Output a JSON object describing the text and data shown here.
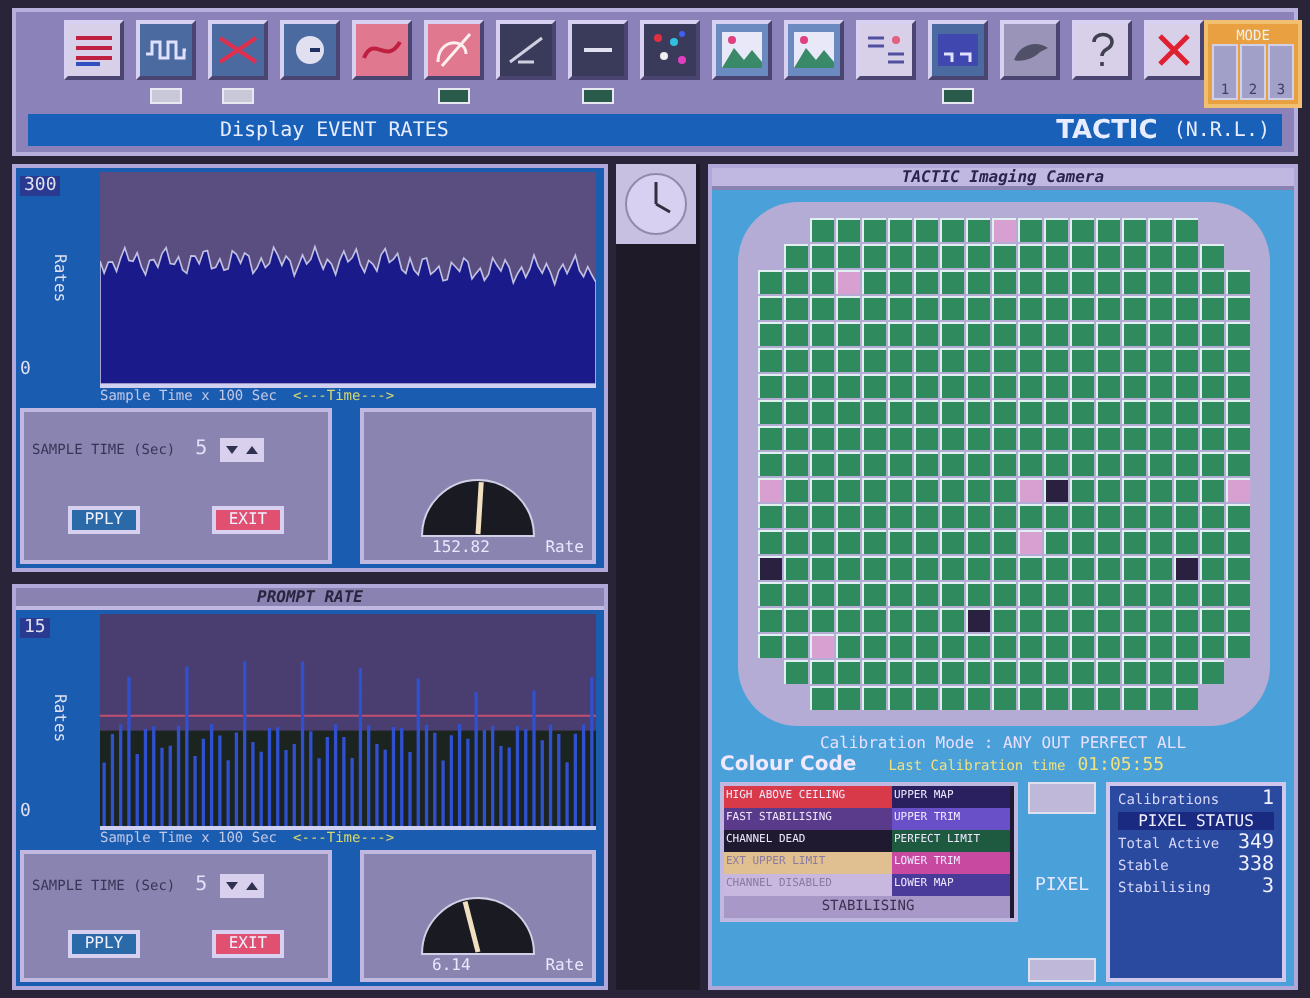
{
  "toolbar": {
    "tools": [
      {
        "kind": "lines"
      },
      {
        "kind": "wave",
        "indicator": {
          "on": false
        }
      },
      {
        "kind": "cross",
        "indicator": {
          "on": false
        }
      },
      {
        "kind": "dial"
      },
      {
        "kind": "curve"
      },
      {
        "kind": "hook",
        "indicator": {
          "on": true
        }
      },
      {
        "kind": "scope"
      },
      {
        "kind": "dash",
        "indicator": {
          "on": true
        }
      },
      {
        "kind": "dots"
      },
      {
        "kind": "hills"
      },
      {
        "kind": "hills"
      },
      {
        "kind": "table"
      },
      {
        "kind": "screen",
        "indicator": {
          "on": true
        }
      },
      {
        "kind": "creature"
      },
      {
        "kind": "help"
      },
      {
        "kind": "close"
      }
    ],
    "mode": {
      "title": "MODE",
      "buttons": [
        "1",
        "2",
        "3"
      ]
    }
  },
  "status_bar": {
    "message": "Display EVENT RATES",
    "app": "TACTIC",
    "org": "(N.R.L.)"
  },
  "rate_panels": [
    {
      "ymax": "300",
      "ymin": "0",
      "ylabel": "Rates",
      "xlabel": "Sample Time x 100 Sec",
      "time_label": "<---Time--->",
      "sample_label": "SAMPLE TIME (Sec)",
      "sample_value": "5",
      "apply": "PPLY",
      "exit": "EXIT",
      "gauge": {
        "reading": "152.82",
        "label": "Rate"
      }
    },
    {
      "title": "PROMPT RATE",
      "ymax": "15",
      "ymin": "0",
      "ylabel": "Rates",
      "xlabel": "Sample Time x 100 Sec",
      "time_label": "<---Time--->",
      "sample_label": "SAMPLE TIME (Sec)",
      "sample_value": "5",
      "apply": "PPLY",
      "exit": "EXIT",
      "gauge": {
        "reading": "6.14",
        "label": "Rate"
      }
    }
  ],
  "camera": {
    "title": "TACTIC Imaging Camera",
    "rows": [
      [
        {
          "kind": "ok"
        },
        {
          "kind": "ok"
        },
        {
          "kind": "ok"
        },
        {
          "kind": "ok"
        },
        {
          "kind": "ok"
        },
        {
          "kind": "ok"
        },
        {
          "kind": "ok"
        },
        {
          "kind": "hot"
        },
        {
          "kind": "ok"
        },
        {
          "kind": "ok"
        },
        {
          "kind": "ok"
        },
        {
          "kind": "ok"
        },
        {
          "kind": "ok"
        },
        {
          "kind": "ok"
        },
        {
          "kind": "ok"
        }
      ],
      [
        {
          "kind": "ok"
        },
        {
          "kind": "ok"
        },
        {
          "kind": "ok"
        },
        {
          "kind": "ok"
        },
        {
          "kind": "ok"
        },
        {
          "kind": "ok"
        },
        {
          "kind": "ok"
        },
        {
          "kind": "ok"
        },
        {
          "kind": "ok"
        },
        {
          "kind": "ok"
        },
        {
          "kind": "ok"
        },
        {
          "kind": "ok"
        },
        {
          "kind": "ok"
        },
        {
          "kind": "ok"
        },
        {
          "kind": "ok"
        },
        {
          "kind": "ok"
        },
        {
          "kind": "ok"
        }
      ],
      [
        {
          "kind": "ok"
        },
        {
          "kind": "ok"
        },
        {
          "kind": "ok"
        },
        {
          "kind": "hot"
        },
        {
          "kind": "ok"
        },
        {
          "kind": "ok"
        },
        {
          "kind": "ok"
        },
        {
          "kind": "ok"
        },
        {
          "kind": "ok"
        },
        {
          "kind": "ok"
        },
        {
          "kind": "ok"
        },
        {
          "kind": "ok"
        },
        {
          "kind": "ok"
        },
        {
          "kind": "ok"
        },
        {
          "kind": "ok"
        },
        {
          "kind": "ok"
        },
        {
          "kind": "ok"
        },
        {
          "kind": "ok"
        },
        {
          "kind": "ok"
        }
      ],
      [
        {
          "kind": "ok"
        },
        {
          "kind": "ok"
        },
        {
          "kind": "ok"
        },
        {
          "kind": "ok"
        },
        {
          "kind": "ok"
        },
        {
          "kind": "ok"
        },
        {
          "kind": "ok"
        },
        {
          "kind": "ok"
        },
        {
          "kind": "ok"
        },
        {
          "kind": "ok"
        },
        {
          "kind": "ok"
        },
        {
          "kind": "ok"
        },
        {
          "kind": "ok"
        },
        {
          "kind": "ok"
        },
        {
          "kind": "ok"
        },
        {
          "kind": "ok"
        },
        {
          "kind": "ok"
        },
        {
          "kind": "ok"
        },
        {
          "kind": "ok"
        }
      ],
      [
        {
          "kind": "ok"
        },
        {
          "kind": "ok"
        },
        {
          "kind": "ok"
        },
        {
          "kind": "ok"
        },
        {
          "kind": "ok"
        },
        {
          "kind": "ok"
        },
        {
          "kind": "ok"
        },
        {
          "kind": "ok"
        },
        {
          "kind": "ok"
        },
        {
          "kind": "ok"
        },
        {
          "kind": "ok"
        },
        {
          "kind": "ok"
        },
        {
          "kind": "ok"
        },
        {
          "kind": "ok"
        },
        {
          "kind": "ok"
        },
        {
          "kind": "ok"
        },
        {
          "kind": "ok"
        },
        {
          "kind": "ok"
        },
        {
          "kind": "ok"
        }
      ],
      [
        {
          "kind": "ok"
        },
        {
          "kind": "ok"
        },
        {
          "kind": "ok"
        },
        {
          "kind": "ok"
        },
        {
          "kind": "ok"
        },
        {
          "kind": "ok"
        },
        {
          "kind": "ok"
        },
        {
          "kind": "ok"
        },
        {
          "kind": "ok"
        },
        {
          "kind": "ok"
        },
        {
          "kind": "ok"
        },
        {
          "kind": "ok"
        },
        {
          "kind": "ok"
        },
        {
          "kind": "ok"
        },
        {
          "kind": "ok"
        },
        {
          "kind": "ok"
        },
        {
          "kind": "ok"
        },
        {
          "kind": "ok"
        },
        {
          "kind": "ok"
        }
      ],
      [
        {
          "kind": "ok"
        },
        {
          "kind": "ok"
        },
        {
          "kind": "ok"
        },
        {
          "kind": "ok"
        },
        {
          "kind": "ok"
        },
        {
          "kind": "ok"
        },
        {
          "kind": "ok"
        },
        {
          "kind": "ok"
        },
        {
          "kind": "ok"
        },
        {
          "kind": "ok"
        },
        {
          "kind": "ok"
        },
        {
          "kind": "ok"
        },
        {
          "kind": "ok"
        },
        {
          "kind": "ok"
        },
        {
          "kind": "ok"
        },
        {
          "kind": "ok"
        },
        {
          "kind": "ok"
        },
        {
          "kind": "ok"
        },
        {
          "kind": "ok"
        }
      ],
      [
        {
          "kind": "ok"
        },
        {
          "kind": "ok"
        },
        {
          "kind": "ok"
        },
        {
          "kind": "ok"
        },
        {
          "kind": "ok"
        },
        {
          "kind": "ok"
        },
        {
          "kind": "ok"
        },
        {
          "kind": "ok"
        },
        {
          "kind": "ok"
        },
        {
          "kind": "ok"
        },
        {
          "kind": "ok"
        },
        {
          "kind": "ok"
        },
        {
          "kind": "ok"
        },
        {
          "kind": "ok"
        },
        {
          "kind": "ok"
        },
        {
          "kind": "ok"
        },
        {
          "kind": "ok"
        },
        {
          "kind": "ok"
        },
        {
          "kind": "ok"
        }
      ],
      [
        {
          "kind": "ok"
        },
        {
          "kind": "ok"
        },
        {
          "kind": "ok"
        },
        {
          "kind": "ok"
        },
        {
          "kind": "ok"
        },
        {
          "kind": "ok"
        },
        {
          "kind": "ok"
        },
        {
          "kind": "ok"
        },
        {
          "kind": "ok"
        },
        {
          "kind": "ok"
        },
        {
          "kind": "ok"
        },
        {
          "kind": "ok"
        },
        {
          "kind": "ok"
        },
        {
          "kind": "ok"
        },
        {
          "kind": "ok"
        },
        {
          "kind": "ok"
        },
        {
          "kind": "ok"
        },
        {
          "kind": "ok"
        },
        {
          "kind": "ok"
        }
      ],
      [
        {
          "kind": "ok"
        },
        {
          "kind": "ok"
        },
        {
          "kind": "ok"
        },
        {
          "kind": "ok"
        },
        {
          "kind": "ok"
        },
        {
          "kind": "ok"
        },
        {
          "kind": "ok"
        },
        {
          "kind": "ok"
        },
        {
          "kind": "ok"
        },
        {
          "kind": "ok"
        },
        {
          "kind": "ok"
        },
        {
          "kind": "ok"
        },
        {
          "kind": "ok"
        },
        {
          "kind": "ok"
        },
        {
          "kind": "ok"
        },
        {
          "kind": "ok"
        },
        {
          "kind": "ok"
        },
        {
          "kind": "ok"
        },
        {
          "kind": "ok"
        }
      ],
      [
        {
          "kind": "hot"
        },
        {
          "kind": "ok"
        },
        {
          "kind": "ok"
        },
        {
          "kind": "ok"
        },
        {
          "kind": "ok"
        },
        {
          "kind": "ok"
        },
        {
          "kind": "ok"
        },
        {
          "kind": "ok"
        },
        {
          "kind": "ok"
        },
        {
          "kind": "ok"
        },
        {
          "kind": "hot"
        },
        {
          "kind": "dead"
        },
        {
          "kind": "ok"
        },
        {
          "kind": "ok"
        },
        {
          "kind": "ok"
        },
        {
          "kind": "ok"
        },
        {
          "kind": "ok"
        },
        {
          "kind": "ok"
        },
        {
          "kind": "hot"
        }
      ],
      [
        {
          "kind": "ok"
        },
        {
          "kind": "ok"
        },
        {
          "kind": "ok"
        },
        {
          "kind": "ok"
        },
        {
          "kind": "ok"
        },
        {
          "kind": "ok"
        },
        {
          "kind": "ok"
        },
        {
          "kind": "ok"
        },
        {
          "kind": "ok"
        },
        {
          "kind": "ok"
        },
        {
          "kind": "ok"
        },
        {
          "kind": "ok"
        },
        {
          "kind": "ok"
        },
        {
          "kind": "ok"
        },
        {
          "kind": "ok"
        },
        {
          "kind": "ok"
        },
        {
          "kind": "ok"
        },
        {
          "kind": "ok"
        },
        {
          "kind": "ok"
        }
      ],
      [
        {
          "kind": "ok"
        },
        {
          "kind": "ok"
        },
        {
          "kind": "ok"
        },
        {
          "kind": "ok"
        },
        {
          "kind": "ok"
        },
        {
          "kind": "ok"
        },
        {
          "kind": "ok"
        },
        {
          "kind": "ok"
        },
        {
          "kind": "ok"
        },
        {
          "kind": "ok"
        },
        {
          "kind": "hot"
        },
        {
          "kind": "ok"
        },
        {
          "kind": "ok"
        },
        {
          "kind": "ok"
        },
        {
          "kind": "ok"
        },
        {
          "kind": "ok"
        },
        {
          "kind": "ok"
        },
        {
          "kind": "ok"
        },
        {
          "kind": "ok"
        }
      ],
      [
        {
          "kind": "dead"
        },
        {
          "kind": "ok"
        },
        {
          "kind": "ok"
        },
        {
          "kind": "ok"
        },
        {
          "kind": "ok"
        },
        {
          "kind": "ok"
        },
        {
          "kind": "ok"
        },
        {
          "kind": "ok"
        },
        {
          "kind": "ok"
        },
        {
          "kind": "ok"
        },
        {
          "kind": "ok"
        },
        {
          "kind": "ok"
        },
        {
          "kind": "ok"
        },
        {
          "kind": "ok"
        },
        {
          "kind": "ok"
        },
        {
          "kind": "ok"
        },
        {
          "kind": "dead"
        },
        {
          "kind": "ok"
        },
        {
          "kind": "ok"
        }
      ],
      [
        {
          "kind": "ok"
        },
        {
          "kind": "ok"
        },
        {
          "kind": "ok"
        },
        {
          "kind": "ok"
        },
        {
          "kind": "ok"
        },
        {
          "kind": "ok"
        },
        {
          "kind": "ok"
        },
        {
          "kind": "ok"
        },
        {
          "kind": "ok"
        },
        {
          "kind": "ok"
        },
        {
          "kind": "ok"
        },
        {
          "kind": "ok"
        },
        {
          "kind": "ok"
        },
        {
          "kind": "ok"
        },
        {
          "kind": "ok"
        },
        {
          "kind": "ok"
        },
        {
          "kind": "ok"
        },
        {
          "kind": "ok"
        },
        {
          "kind": "ok"
        }
      ],
      [
        {
          "kind": "ok"
        },
        {
          "kind": "ok"
        },
        {
          "kind": "ok"
        },
        {
          "kind": "ok"
        },
        {
          "kind": "ok"
        },
        {
          "kind": "ok"
        },
        {
          "kind": "ok"
        },
        {
          "kind": "ok"
        },
        {
          "kind": "dead"
        },
        {
          "kind": "ok"
        },
        {
          "kind": "ok"
        },
        {
          "kind": "ok"
        },
        {
          "kind": "ok"
        },
        {
          "kind": "ok"
        },
        {
          "kind": "ok"
        },
        {
          "kind": "ok"
        },
        {
          "kind": "ok"
        },
        {
          "kind": "ok"
        },
        {
          "kind": "ok"
        }
      ],
      [
        {
          "kind": "ok"
        },
        {
          "kind": "ok"
        },
        {
          "kind": "hot"
        },
        {
          "kind": "ok"
        },
        {
          "kind": "ok"
        },
        {
          "kind": "ok"
        },
        {
          "kind": "ok"
        },
        {
          "kind": "ok"
        },
        {
          "kind": "ok"
        },
        {
          "kind": "ok"
        },
        {
          "kind": "ok"
        },
        {
          "kind": "ok"
        },
        {
          "kind": "ok"
        },
        {
          "kind": "ok"
        },
        {
          "kind": "ok"
        },
        {
          "kind": "ok"
        },
        {
          "kind": "ok"
        },
        {
          "kind": "ok"
        },
        {
          "kind": "ok"
        }
      ],
      [
        {
          "kind": "ok"
        },
        {
          "kind": "ok"
        },
        {
          "kind": "ok"
        },
        {
          "kind": "ok"
        },
        {
          "kind": "ok"
        },
        {
          "kind": "ok"
        },
        {
          "kind": "ok"
        },
        {
          "kind": "ok"
        },
        {
          "kind": "ok"
        },
        {
          "kind": "ok"
        },
        {
          "kind": "ok"
        },
        {
          "kind": "ok"
        },
        {
          "kind": "ok"
        },
        {
          "kind": "ok"
        },
        {
          "kind": "ok"
        },
        {
          "kind": "ok"
        },
        {
          "kind": "ok"
        }
      ],
      [
        {
          "kind": "ok"
        },
        {
          "kind": "ok"
        },
        {
          "kind": "ok"
        },
        {
          "kind": "ok"
        },
        {
          "kind": "ok"
        },
        {
          "kind": "ok"
        },
        {
          "kind": "ok"
        },
        {
          "kind": "ok"
        },
        {
          "kind": "ok"
        },
        {
          "kind": "ok"
        },
        {
          "kind": "ok"
        },
        {
          "kind": "ok"
        },
        {
          "kind": "ok"
        },
        {
          "kind": "ok"
        },
        {
          "kind": "ok"
        }
      ]
    ],
    "calibration_mode": "Calibration Mode : ANY OUT PERFECT ALL",
    "colour_code_title": "Colour Code",
    "last_calibration_label": "Last Calibration time",
    "last_calibration_time": "01:05:55",
    "colour_codes": [
      {
        "label": "HIGH ABOVE CEILING",
        "color": "#d83a4a"
      },
      {
        "label": "UPPER MAP",
        "color": "#2a2060"
      },
      {
        "label": "FAST STABILISING",
        "color": "#5a3a8a"
      },
      {
        "label": "UPPER TRIM",
        "color": "#6a50c8"
      },
      {
        "label": "CHANNEL DEAD",
        "color": "#201a30"
      },
      {
        "label": "PERFECT LIMIT",
        "color": "#1e5a40"
      },
      {
        "label": "EXT UPPER LIMIT",
        "color": "#e0c090"
      },
      {
        "label": "LOWER TRIM",
        "color": "#c84aa0"
      },
      {
        "label": "CHANNEL DISABLED",
        "color": "#c8b8e0"
      },
      {
        "label": "LOWER MAP",
        "color": "#4a3a9a"
      }
    ],
    "stabilising": "STABILISING",
    "pixel_label": "PIXEL",
    "status": {
      "calibrations_label": "Calibrations",
      "calibrations": "1",
      "title": "PIXEL STATUS",
      "stats": [
        {
          "label": "Total Active",
          "value": "349"
        },
        {
          "label": "Stable",
          "value": "338"
        },
        {
          "label": "Stabilising",
          "value": "3"
        }
      ]
    }
  }
}
